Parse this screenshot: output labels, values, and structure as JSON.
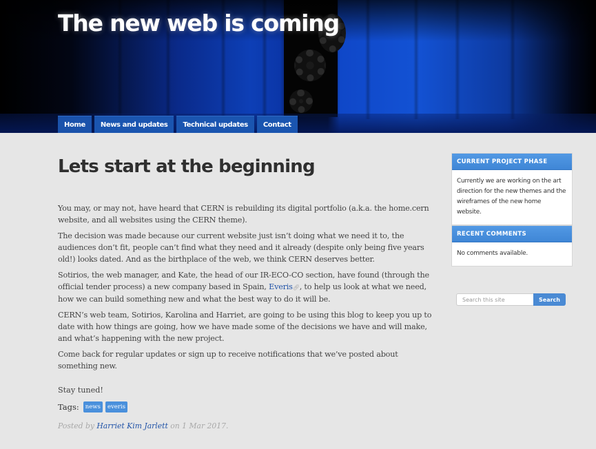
{
  "site": {
    "title": "The new web is coming"
  },
  "nav": {
    "items": [
      {
        "label": "Home",
        "active": true
      },
      {
        "label": "News and updates",
        "active": false
      },
      {
        "label": "Technical updates",
        "active": false
      },
      {
        "label": "Contact",
        "active": false
      }
    ]
  },
  "post": {
    "title": "Lets start at the beginning",
    "paragraphs": [
      "You may, or may not, have heard that CERN is rebuilding its digital portfolio (a.k.a. the home.cern website, and all websites using the CERN theme).",
      "The decision was made because our current website just isn’t doing what we need it to, the audiences don’t fit, people can’t find what they need and it already (despite only being five years old!) looks dated. And as the birthplace of the web, we think CERN deserves better.",
      "CERN’s web team, Sotirios, Karolina and Harriet, are going to be using this blog to keep you up to date with how things are going, how we have made some of the decisions we have and will make, and what’s happening with the new project.",
      "Come back for regular updates or sign up to receive notifications that we’ve posted about something new."
    ],
    "p3_before": "Sotirios, the web manager, and Kate, the head of our IR-ECO-CO section, have found (through the official tender process) a new company based in Spain, ",
    "p3_link": "Everis",
    "p3_link_icon": "external-link-icon",
    "p3_after": ", to help us look at what we need, how we can build something new and what the best way to do it will be.",
    "closing": "Stay tuned!",
    "tags_label": "Tags:",
    "tags": [
      "news",
      "everis"
    ],
    "posted_by_prefix": "Posted by ",
    "author": "Harriet Kim Jarlett",
    "posted_on": " on 1 Mar 2017."
  },
  "sidebar": {
    "widgets": [
      {
        "title": "CURRENT PROJECT PHASE",
        "body": "Currently we are working on the art direction for the new themes and the wireframes of the new home website."
      },
      {
        "title": "RECENT COMMENTS",
        "body": "No comments available."
      }
    ],
    "search": {
      "placeholder": "Search this site",
      "value": "",
      "button_label": "Search"
    }
  },
  "colors": {
    "nav_bg": "#1a55b0",
    "widget_header": "#4a90dc",
    "link": "#2254a8",
    "tag_bg": "#4a90dc"
  }
}
